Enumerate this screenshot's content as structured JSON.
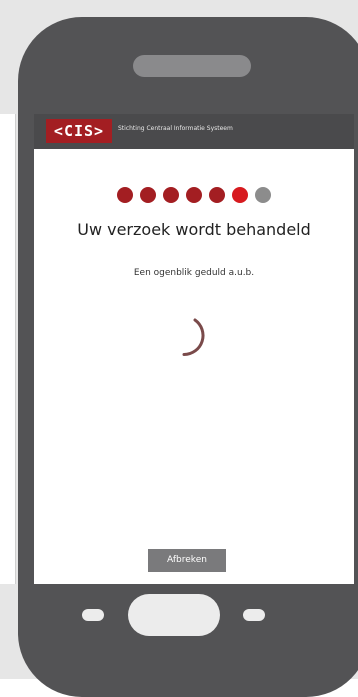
{
  "header": {
    "logo_text": "<CIS>",
    "title": "Stichting Centraal Informatie Systeem"
  },
  "progress": {
    "total_steps": 7,
    "current_step": 6,
    "colors": {
      "done": "#a31e22",
      "current": "#d71a1f",
      "pending": "#8c8c8c"
    }
  },
  "main": {
    "heading": "Uw verzoek wordt behandeld",
    "subtext": "Een ogenblik geduld a.u.b.",
    "spinner_icon": "loading-spinner-icon"
  },
  "actions": {
    "cancel_label": "Afbreken"
  },
  "colors": {
    "brand": "#a31e22",
    "phone_body": "#535355",
    "spinner": "#7a4a4a"
  }
}
